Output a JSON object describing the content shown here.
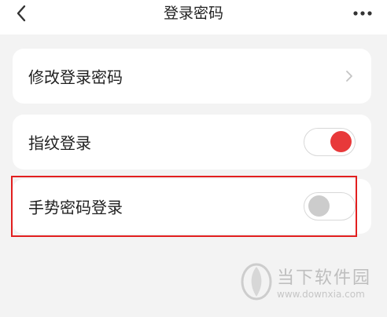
{
  "header": {
    "title": "登录密码",
    "back_icon": "chevron-left-icon",
    "more_icon": "more-horizontal-icon"
  },
  "settings": {
    "items": [
      {
        "label": "修改登录密码",
        "control": "chevron-right-icon"
      },
      {
        "label": "指纹登录",
        "control": "toggle",
        "enabled": true
      },
      {
        "label": "手势密码登录",
        "control": "toggle",
        "enabled": false
      }
    ]
  },
  "watermark": {
    "text": "当下软件园",
    "url": "www.downxia.com"
  },
  "colors": {
    "accent": "#e8393a",
    "highlight": "#e21f1f",
    "background": "#f3f3f3",
    "card": "#ffffff"
  }
}
